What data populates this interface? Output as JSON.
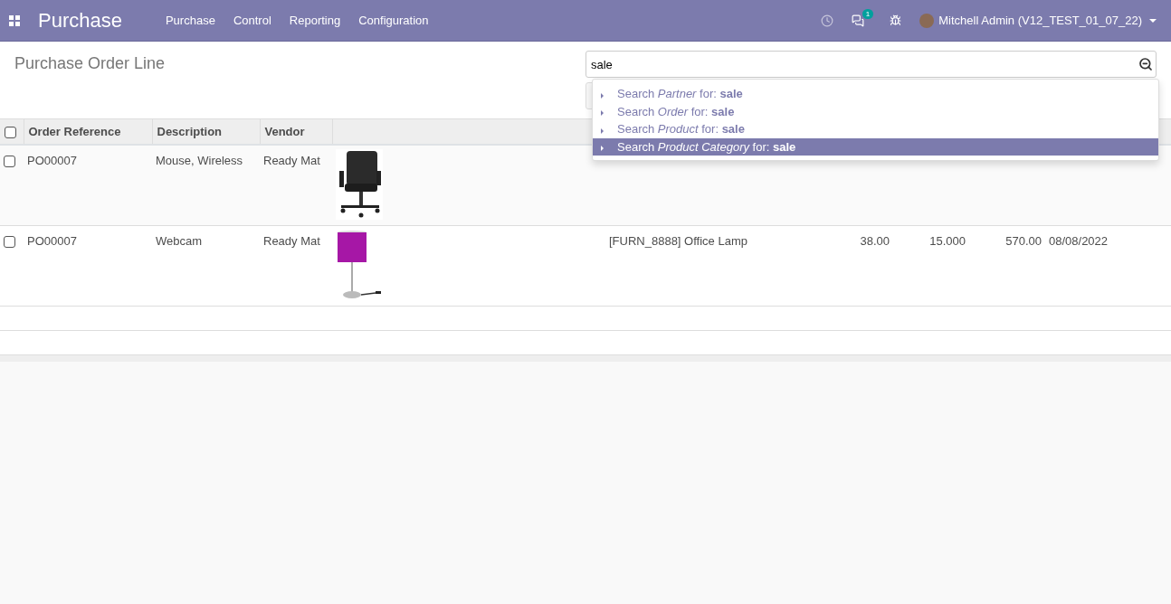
{
  "navbar": {
    "app_title": "Purchase",
    "menu": [
      {
        "label": "Purchase"
      },
      {
        "label": "Control"
      },
      {
        "label": "Reporting"
      },
      {
        "label": "Configuration"
      }
    ],
    "messages_badge": "1",
    "user": "Mitchell Admin (V12_TEST_01_07_22)"
  },
  "control_panel": {
    "title": "Purchase Order Line",
    "search": {
      "value": "sale"
    },
    "suggestions": [
      {
        "text": "Search *Partner* for: **sale**",
        "selected": false
      },
      {
        "text": "Search *Order* for: **sale**",
        "selected": false
      },
      {
        "text": "Search *Product* for: **sale**",
        "selected": false
      },
      {
        "text": "Search *Product Category* for: **sale**",
        "selected": true
      }
    ]
  },
  "table": {
    "columns": [
      "Order Reference",
      "Description",
      "Vendor"
    ],
    "select_all": {
      "checked": false
    },
    "rows": [
      {
        "checked": false,
        "order_reference": "PO00007",
        "description": "Mouse, Wireless",
        "vendor": "Ready Mat"
      },
      {
        "checked": false,
        "order_reference": "PO00007",
        "description": "Webcam",
        "vendor": "Ready Mat",
        "product": "[FURN_8888] Office Lamp",
        "unit_price": "38.00",
        "quantity": "15.000",
        "subtotal": "570.00",
        "date": "08/08/2022"
      }
    ]
  }
}
